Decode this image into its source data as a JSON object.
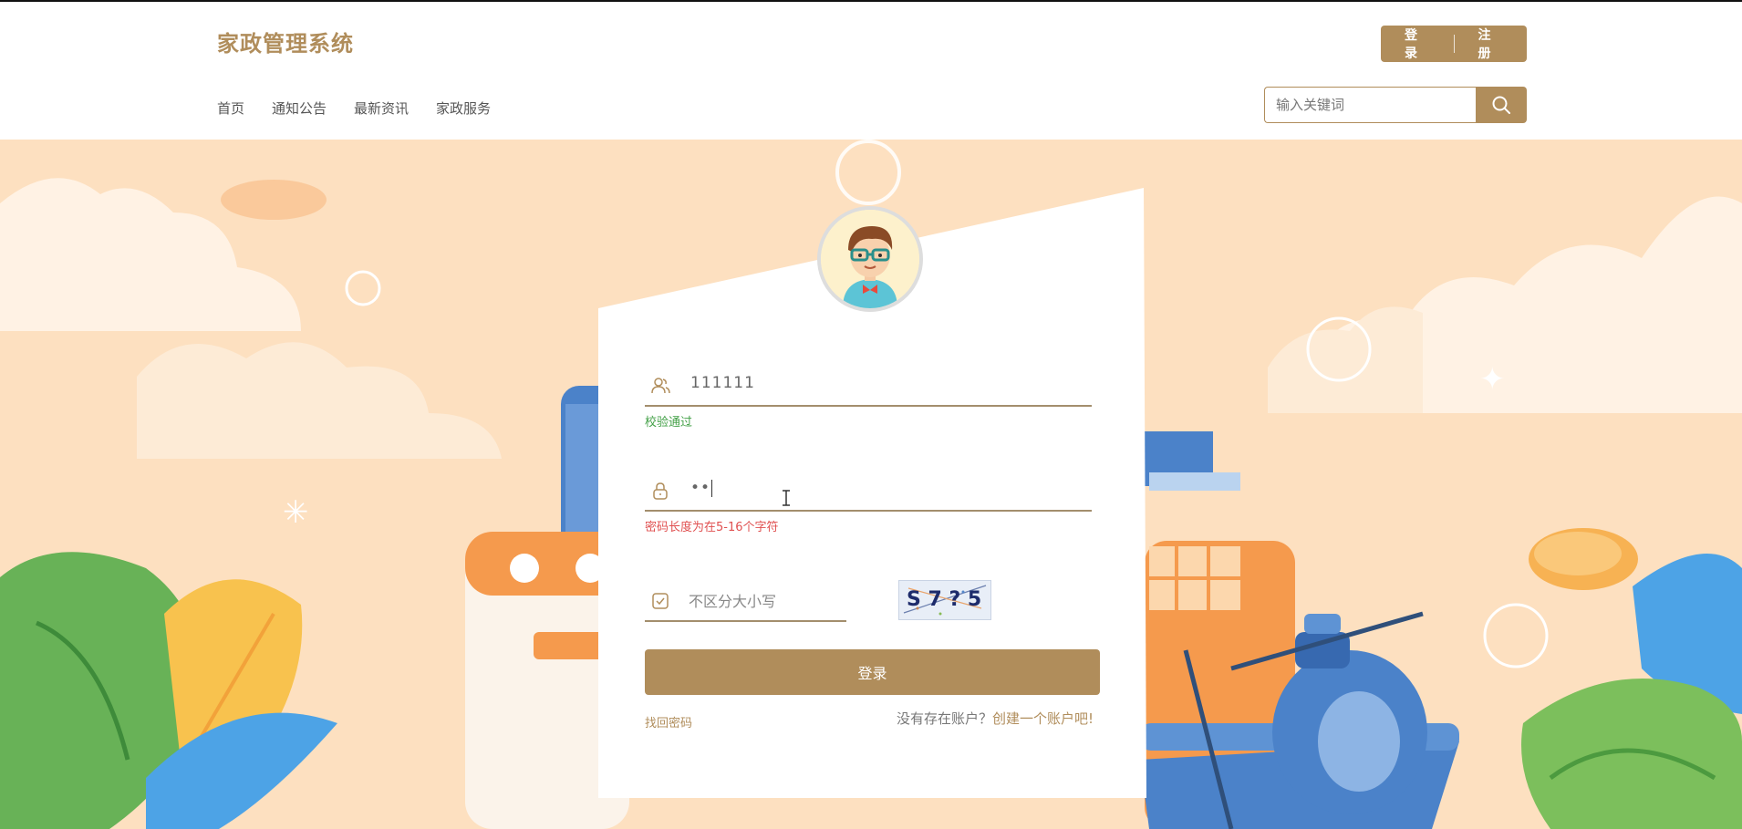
{
  "header": {
    "brand": "家政管理系统",
    "login_label": "登录",
    "register_label": "注册",
    "nav": [
      {
        "label": "首页"
      },
      {
        "label": "通知公告"
      },
      {
        "label": "最新资讯"
      },
      {
        "label": "家政服务"
      }
    ],
    "search": {
      "placeholder": "输入关键词",
      "value": ""
    }
  },
  "login": {
    "username": {
      "value": "111111",
      "hint": "校验通过"
    },
    "password": {
      "masked_value": "••",
      "hint": "密码长度为在5-16个字符"
    },
    "captcha": {
      "placeholder": "不区分大小写",
      "image_text": "S 7 ? 5"
    },
    "submit_label": "登录",
    "forgot_label": "找回密码",
    "no_account_label": "没有存在账户？",
    "create_account_label": "创建一个账户吧!"
  },
  "colors": {
    "accent": "#b08d5b",
    "background": "#fde0c0",
    "ok_hint": "#43a047",
    "error_hint": "#e05050"
  },
  "icons": {
    "search": "search-icon",
    "user": "user-icon",
    "lock": "lock-icon",
    "captcha": "check-square-icon"
  }
}
